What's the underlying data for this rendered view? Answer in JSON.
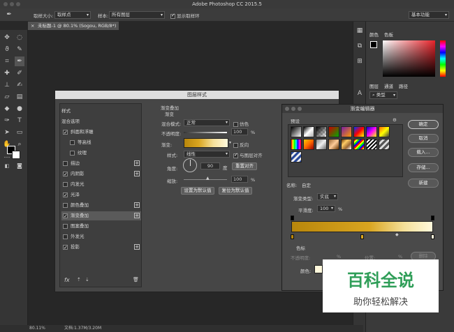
{
  "app": {
    "window_title": "Adobe Photoshop CC 2015.5"
  },
  "options_bar": {
    "sample_size_label": "取样大小:",
    "sample_size_value": "取样点",
    "sample_label": "样本:",
    "sample_value": "所有图层",
    "show_ring_label": "显示取样环",
    "workspace_value": "基本功能"
  },
  "document": {
    "tab_label": "未标题-1 @ 80.1% (Sogou, RGB/8*) *"
  },
  "status": {
    "zoom": "80.11%",
    "doc_size": "文档:1.37M/3.20M"
  },
  "right_panel": {
    "color_tabs": [
      "颜色",
      "色板"
    ],
    "layer_tabs": [
      "图层",
      "通道",
      "路径"
    ],
    "kind_label": "类型"
  },
  "layer_style": {
    "title": "图层样式",
    "style_header": "样式",
    "blend_options": "混合选项",
    "items": [
      {
        "label": "斜面和浮雕",
        "checked": true,
        "plus": false
      },
      {
        "label": "等高线",
        "checked": false,
        "plus": false
      },
      {
        "label": "纹理",
        "checked": false,
        "plus": false
      },
      {
        "label": "描边",
        "checked": false,
        "plus": true
      },
      {
        "label": "内阴影",
        "checked": true,
        "plus": true
      },
      {
        "label": "内发光",
        "checked": false,
        "plus": false
      },
      {
        "label": "光泽",
        "checked": true,
        "plus": false
      },
      {
        "label": "颜色叠加",
        "checked": false,
        "plus": true
      },
      {
        "label": "渐变叠加",
        "checked": true,
        "plus": true
      },
      {
        "label": "图案叠加",
        "checked": false,
        "plus": false
      },
      {
        "label": "外发光",
        "checked": false,
        "plus": false
      },
      {
        "label": "投影",
        "checked": true,
        "plus": true
      }
    ],
    "fx_label": "fx",
    "section_title": "渐变叠加",
    "section_subtitle": "渐变",
    "blend_mode_label": "混合模式:",
    "blend_mode_value": "正常",
    "dither_label": "仿色",
    "opacity_label": "不透明度:",
    "opacity_value": "100",
    "opacity_unit": "%",
    "gradient_label": "渐变:",
    "reverse_label": "反向",
    "style_label": "样式:",
    "style_value": "线性",
    "align_layer_label": "与图层对齐",
    "angle_label": "角度:",
    "angle_value": "90",
    "angle_unit": "度",
    "reset_align_button": "重置对齐",
    "scale_label": "缩放:",
    "scale_value": "100",
    "scale_unit": "%",
    "set_default_button": "设置为默认值",
    "reset_default_button": "复位为默认值"
  },
  "gradient_editor": {
    "title": "渐变编辑器",
    "presets_label": "预设",
    "ok_button": "确定",
    "cancel_button": "取消",
    "load_button": "载入...",
    "save_button": "存储...",
    "name_label": "名称:",
    "name_value": "自定",
    "new_button": "新建",
    "type_label": "渐变类型:",
    "type_value": "实底",
    "smooth_label": "平滑度:",
    "smooth_value": "100",
    "smooth_unit": "%",
    "stops_label": "色标",
    "opacity_label": "不透明度:",
    "opacity_unit": "%",
    "location_label": "位置:",
    "location_unit": "%",
    "delete_button": "删除",
    "color_label": "颜色:",
    "gradient_colors": [
      "#b8860b",
      "#d9a520",
      "#f5e09a",
      "#fff8dc"
    ]
  },
  "watermark": {
    "main": "百科全说",
    "sub": "助你轻松解决"
  }
}
